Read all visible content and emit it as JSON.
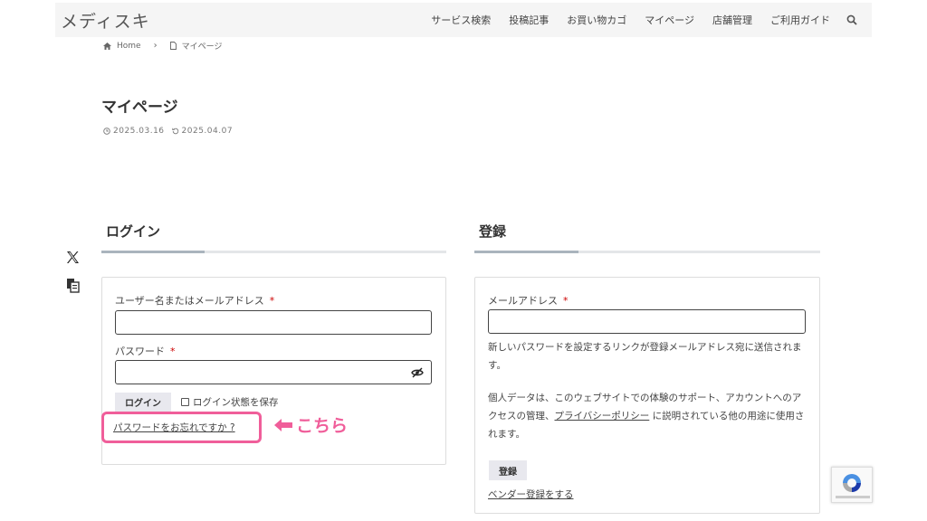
{
  "header": {
    "logo": "メディスキ",
    "nav": [
      "サービス検索",
      "投稿記事",
      "お買い物カゴ",
      "マイページ",
      "店舗管理",
      "ご利用ガイド"
    ]
  },
  "breadcrumb": {
    "home": "Home",
    "current": "マイページ"
  },
  "page": {
    "title": "マイページ",
    "published": "2025.03.16",
    "updated": "2025.04.07"
  },
  "login": {
    "title": "ログイン",
    "username_label": "ユーザー名またはメールアドレス",
    "password_label": "パスワード",
    "required_mark": "*",
    "button": "ログイン",
    "remember": "ログイン状態を保存",
    "forgot": "パスワードをお忘れですか ?"
  },
  "register": {
    "title": "登録",
    "email_label": "メールアドレス",
    "required_mark": "*",
    "info": "新しいパスワードを設定するリンクが登録メールアドレス宛に送信されます。",
    "privacy_before": "個人データは、このウェブサイトでの体験のサポート、アカウントへのアクセスの管理、",
    "privacy_link": "プライバシーポリシー",
    "privacy_after": " に説明されている他の用途に使用されます。",
    "button": "登録",
    "vendor_link": "ベンダー登録をする"
  },
  "annotation": {
    "text": "こちら",
    "color": "#f05e9a"
  },
  "icons": [
    "x-icon",
    "copy-icon",
    "search-icon",
    "home-icon",
    "page-icon",
    "clock-icon",
    "refresh-icon",
    "eye-slash-icon",
    "recaptcha-icon"
  ]
}
